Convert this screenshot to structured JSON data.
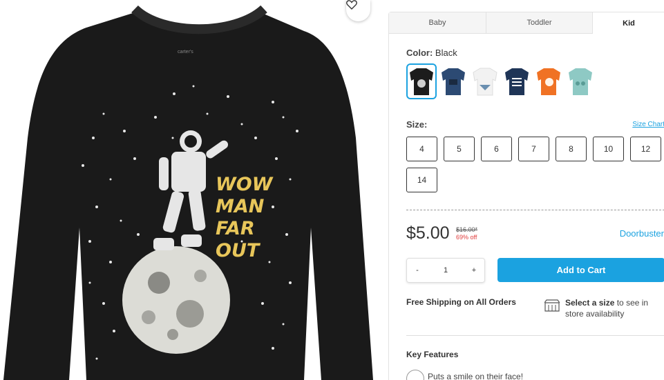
{
  "gallery": {
    "brand_tag": "carter's",
    "graphic_text": [
      "WOW",
      "MAN",
      "FAR",
      "OUT"
    ],
    "favorite_icon": "heart-outline-icon"
  },
  "tabs": [
    {
      "label": "Baby"
    },
    {
      "label": "Toddler"
    },
    {
      "label": "Kid",
      "active": true
    }
  ],
  "color": {
    "label": "Color:",
    "value": "Black",
    "swatches": [
      {
        "name": "black",
        "color": "#1c1c1c",
        "selected": true
      },
      {
        "name": "navy",
        "color": "#2c4a73"
      },
      {
        "name": "white",
        "color": "#f2f2f2"
      },
      {
        "name": "dark-navy",
        "color": "#1f3557"
      },
      {
        "name": "orange",
        "color": "#f07224"
      },
      {
        "name": "aqua",
        "color": "#8ec9c4"
      }
    ]
  },
  "size": {
    "label": "Size:",
    "chart_link": "Size Chart",
    "options": [
      "4",
      "5",
      "6",
      "7",
      "8",
      "10",
      "12",
      "14"
    ]
  },
  "price": {
    "current": "$5.00",
    "original": "$16.00*",
    "discount": "69% off",
    "promo": "Doorbuster"
  },
  "quantity": {
    "decrement": "-",
    "value": "1",
    "increment": "+"
  },
  "cart": {
    "add_label": "Add to Cart"
  },
  "shipping": {
    "free_label": "Free Shipping on All Orders",
    "store_bold": "Select a size",
    "store_rest": " to see in store availability",
    "store_icon": "store-icon"
  },
  "features": {
    "heading": "Key Features",
    "items": [
      "Puts a smile on their face!"
    ]
  },
  "colors": {
    "accent": "#1ba2e0",
    "discount": "#e03b3b",
    "shirt": "#1a1a1a"
  }
}
